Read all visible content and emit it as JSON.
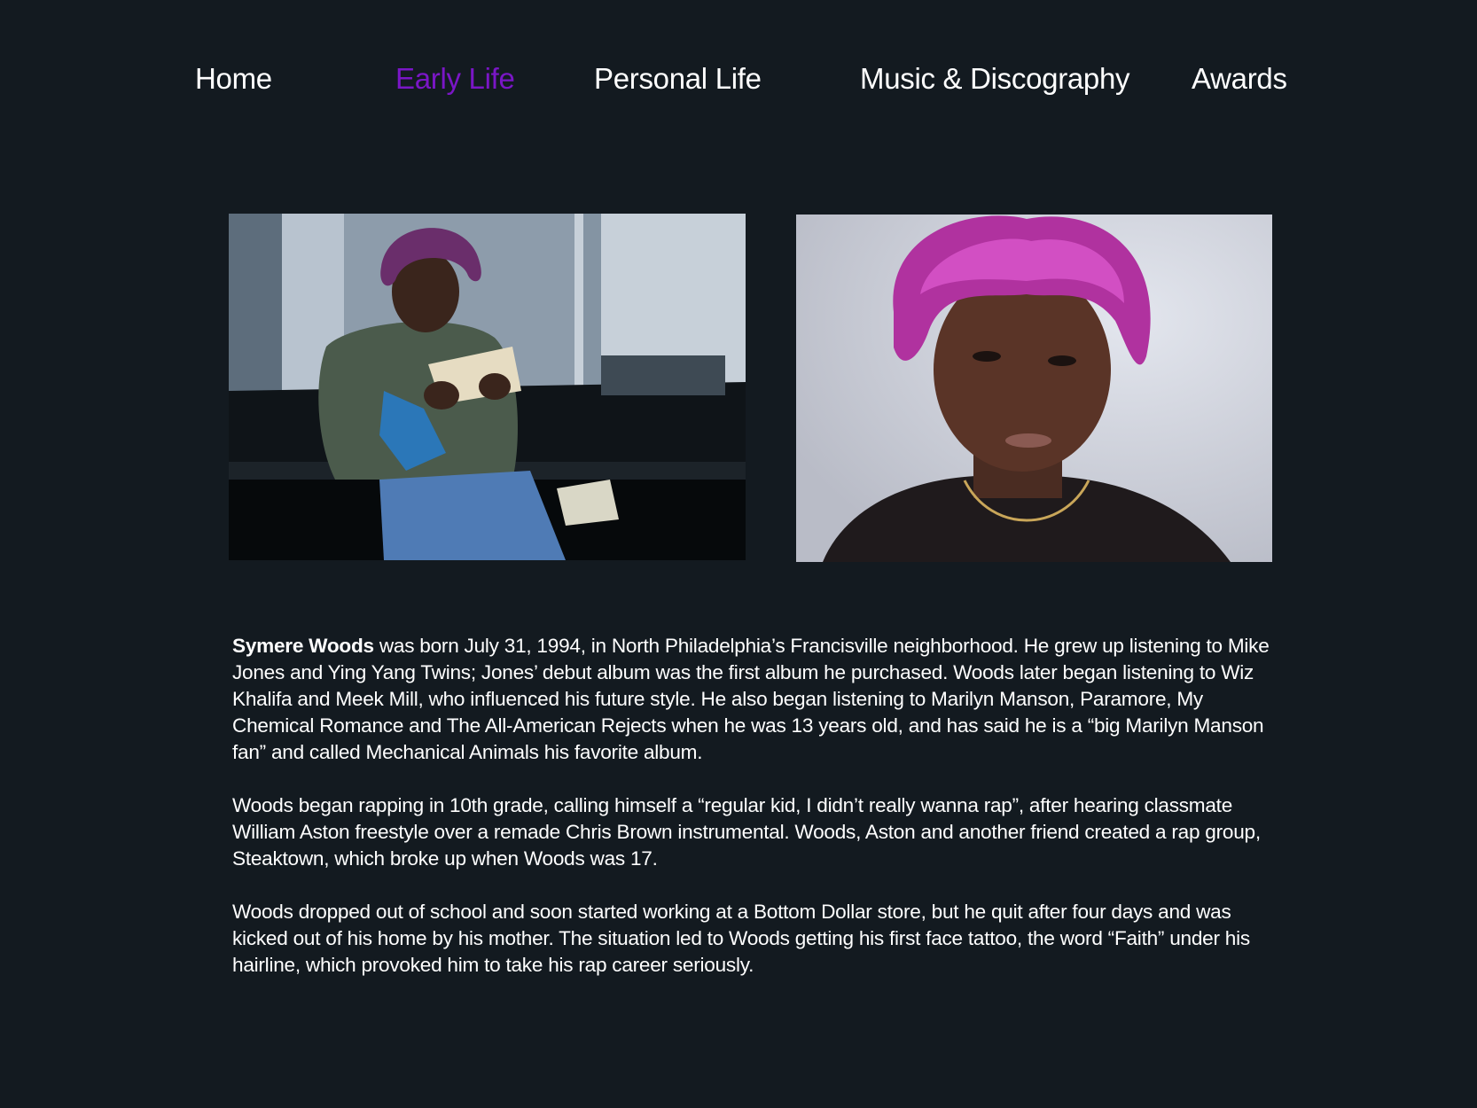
{
  "nav": {
    "items": [
      {
        "label": "Home",
        "active": false
      },
      {
        "label": "Early Life",
        "active": true
      },
      {
        "label": "Personal Life",
        "active": false
      },
      {
        "label": "Music & Discography",
        "active": false
      },
      {
        "label": "Awards",
        "active": false
      }
    ],
    "active_color": "#7a16c6"
  },
  "colors": {
    "background": "#131a20",
    "text": "#ffffff"
  },
  "photos": {
    "left": {
      "icon": "photo-image",
      "description": "man with purple dreadlocks counting cash"
    },
    "right": {
      "icon": "photo-image",
      "description": "portrait of man with magenta dreadlocks"
    }
  },
  "article": {
    "p1_bold": "Symere Woods",
    "p1_rest": " was born July 31, 1994, in North Philadelphia’s Francisville neighborhood. He grew up listening to Mike Jones and Ying Yang Twins; Jones’ debut album was the first album he purchased. Woods later began listening to Wiz Khalifa and Meek Mill, who influenced his future style. He also began listening to Marilyn Manson, Paramore, My Chemical Romance and The All-American Rejects when he was 13 years old, and has said he is a “big Marilyn Manson fan” and called Mechanical Animals his favorite album.",
    "p2": "Woods began rapping in 10th grade, calling himself a “regular kid, I didn’t really wanna rap”, after hearing classmate William Aston freestyle over a remade Chris Brown instrumental. Woods, Aston and another friend created a rap group, Steaktown, which broke up when Woods was 17.",
    "p3": "Woods dropped out of school and soon started working at a Bottom Dollar store, but he quit after four days and was kicked out of his home by his mother. The situation led to Woods getting his first face tattoo, the word “Faith” under his hairline, which provoked him to take his rap career seriously."
  }
}
